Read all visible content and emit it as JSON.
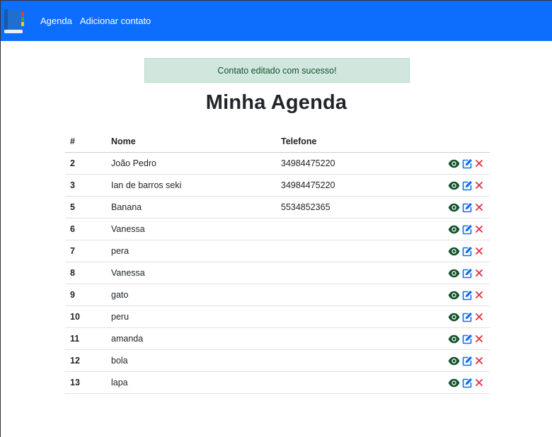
{
  "nav": {
    "brand_icon": "address-book-icon",
    "links": [
      "Agenda",
      "Adicionar contato"
    ]
  },
  "alert": {
    "message": "Contato editado com sucesso!"
  },
  "page_title": "Minha Agenda",
  "table": {
    "headers": [
      "#",
      "Nome",
      "Telefone"
    ],
    "rows": [
      {
        "id": "2",
        "nome": "João Pedro",
        "telefone": "34984475220"
      },
      {
        "id": "3",
        "nome": "Ian de barros seki",
        "telefone": "34984475220"
      },
      {
        "id": "5",
        "nome": "Banana",
        "telefone": "5534852365"
      },
      {
        "id": "6",
        "nome": "Vanessa",
        "telefone": ""
      },
      {
        "id": "7",
        "nome": "pera",
        "telefone": ""
      },
      {
        "id": "8",
        "nome": "Vanessa",
        "telefone": ""
      },
      {
        "id": "9",
        "nome": "gato",
        "telefone": ""
      },
      {
        "id": "10",
        "nome": "peru",
        "telefone": ""
      },
      {
        "id": "11",
        "nome": "amanda",
        "telefone": ""
      },
      {
        "id": "12",
        "nome": "bola",
        "telefone": ""
      },
      {
        "id": "13",
        "nome": "lapa",
        "telefone": ""
      }
    ],
    "action_icons": [
      "eye-icon",
      "edit-icon",
      "delete-icon"
    ]
  },
  "colors": {
    "navbar": "#0d6efd",
    "alert_bg": "#d1e7dd",
    "alert_text": "#0f5132",
    "view_icon": "#14532d",
    "edit_icon": "#0d6efd",
    "delete_icon": "#dc3545"
  }
}
